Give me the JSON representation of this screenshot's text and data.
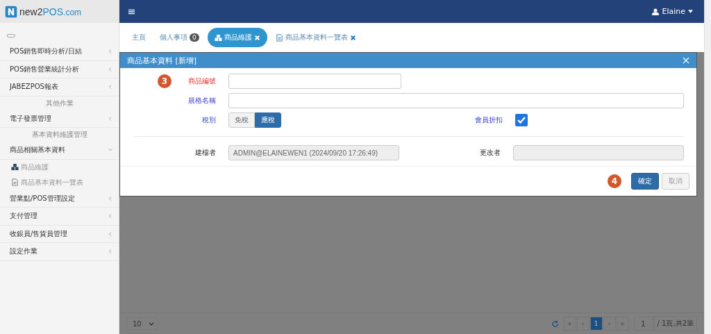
{
  "brand": {
    "name_part1": "new2",
    "name_part2": "POS",
    "name_part3": ".com"
  },
  "user": {
    "name": "Elaine"
  },
  "sidebar": {
    "items": [
      {
        "kind": "group",
        "label": "POS銷售即時分析/日結",
        "expanded": false
      },
      {
        "kind": "group",
        "label": "POS銷售營業統計分析",
        "expanded": false
      },
      {
        "kind": "group",
        "label": "JABEZPOS報表",
        "expanded": false
      },
      {
        "kind": "section",
        "label": "其他作業"
      },
      {
        "kind": "group",
        "label": "電子發票管理",
        "expanded": false
      },
      {
        "kind": "section",
        "label": "基本資料維護管理"
      },
      {
        "kind": "group",
        "label": "商品相關基本資料",
        "expanded": true
      },
      {
        "kind": "maintenance",
        "label": "商品維護"
      },
      {
        "kind": "listing",
        "label": "商品基本資料一覽表"
      },
      {
        "kind": "group",
        "label": "營業點/POS管理設定",
        "expanded": false
      },
      {
        "kind": "group",
        "label": "支付管理",
        "expanded": false
      },
      {
        "kind": "group",
        "label": "收銀員/售貨員管理",
        "expanded": false
      },
      {
        "kind": "group",
        "label": "設定作業",
        "expanded": false
      }
    ]
  },
  "tabs": [
    {
      "kind": "plain",
      "label": "主頁",
      "closable": false,
      "selected": false
    },
    {
      "kind": "plain",
      "label": "個人事項",
      "badge": "0",
      "closable": false,
      "selected": false
    },
    {
      "kind": "maintenance",
      "label": "商品維護",
      "closable": true,
      "selected": true
    },
    {
      "kind": "listing",
      "label": "商品基本資料一覽表",
      "closable": true,
      "selected": false
    }
  ],
  "modal": {
    "title": "商品基本資料 [新增]",
    "step_badges": [
      "3",
      "4"
    ],
    "product_no": {
      "label": "商品編號",
      "required": true
    },
    "spec_name": {
      "label": "規格名稱"
    },
    "tax": {
      "label": "稅別",
      "options": [
        {
          "label": "免稅",
          "selected": false
        },
        {
          "label": "應稅",
          "selected": true
        }
      ]
    },
    "member_discount": {
      "label": "會員折扣",
      "checked": true
    },
    "created_by": {
      "label": "建檔者",
      "value": "ADMIN@ELAINEWEN1 (2024/09/20 17:26:49)"
    },
    "modified_by": {
      "label": "更改者"
    },
    "buttons": [
      {
        "label": "確定",
        "kind": "primary"
      },
      {
        "label": "取消",
        "kind": "default"
      }
    ]
  },
  "pager": {
    "page_size": "10",
    "first": "«",
    "prev": "‹",
    "pages": [
      {
        "label": "1",
        "selected": true
      }
    ],
    "next": "›",
    "last": "»",
    "page_input": "1",
    "summary": "/ 1頁,共2筆"
  }
}
